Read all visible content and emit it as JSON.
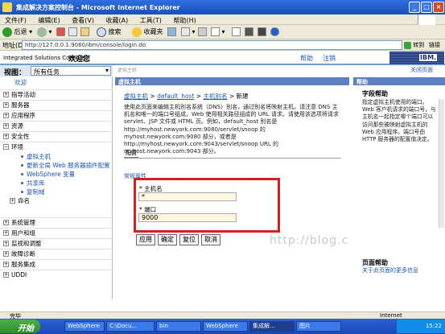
{
  "window": {
    "title": "集成解决方案控制台 - Microsoft Internet Explorer"
  },
  "menu": [
    "文件(F)",
    "编辑(E)",
    "查看(V)",
    "收藏(A)",
    "工具(T)",
    "帮助(H)"
  ],
  "toolbar": {
    "back": "后退",
    "search": "搜索",
    "favorites": "收藏夹"
  },
  "address": {
    "label": "地址(D)",
    "url": "http://127.0.0.1:9060/ibm/console/login.do",
    "go": "转到",
    "links": "链接"
  },
  "console": {
    "title": "Integrated Solutions Console",
    "welcome": "欢迎您",
    "help": "帮助",
    "logout": "注销",
    "ibm": "IBM."
  },
  "nav": {
    "view_label": "视图：",
    "view_value": "所有任务",
    "items": [
      {
        "box": "",
        "label": "欢迎"
      },
      {
        "box": "+",
        "label": "指导活动"
      },
      {
        "box": "+",
        "label": "服务器"
      },
      {
        "box": "+",
        "label": "应用程序"
      },
      {
        "box": "+",
        "label": "资源"
      },
      {
        "box": "+",
        "label": "安全性"
      },
      {
        "box": "−",
        "label": "环境"
      }
    ],
    "sub_items": [
      "虚拟主机",
      "更新全局 Web 服务器插件配置",
      "WebSphere 变量",
      "共享库",
      "复制域"
    ],
    "naming": "命名",
    "items2": [
      {
        "box": "+",
        "label": "系统管理"
      },
      {
        "box": "+",
        "label": "用户和组"
      },
      {
        "box": "+",
        "label": "监视和调整"
      },
      {
        "box": "+",
        "label": "故障诊断"
      },
      {
        "box": "+",
        "label": "服务集成"
      },
      {
        "box": "+",
        "label": "UDDI"
      }
    ]
  },
  "main": {
    "top_crumb": "虚拟主机",
    "panel_title": "虚拟主机",
    "breadcrumb": {
      "a": "虚拟主机",
      "b": "default_host",
      "c": "主机别名",
      "d": "新建"
    },
    "description": "使用此页面来编辑主机别名系统（DNS）别名，通过别名将映射主机。请注意 DNS 主机名和唯一的端口号组成，Web 使用相关路径组成的 URL 请求。请使用该选项将请求 servlet、JSP 文件或 HTML 页。例如，default_host 别名是 http://myhost.newyork.com:9080/servlet/snoop 的 myhost.newyork.com:9080 部分，或者是 http://myhost.newyork.com:9043/servlet/snoop URL 的 myhost.newyork.com:9043 部分。",
    "tab": "配置",
    "section": "常规属性",
    "host_label": "* 主机名",
    "host_value": "*",
    "port_label": "* 端口",
    "port_value": "9000",
    "buttons": {
      "apply": "应用",
      "ok": "确定",
      "reset": "复位",
      "cancel": "取消"
    },
    "watermark": "http://blog.csdn.net/"
  },
  "help": {
    "top_link": "关闭页面",
    "header": "帮助",
    "field_help_title": "字段帮助",
    "field_help_body": "指定虚拟主机使用的端口。Web 客户机请求的端口号，与主机名一起指定哪个端口可以访问那些被映射虚拟主机的 Web 应用程序。端口号由 HTTP 服务器的配置值决定。",
    "page_help_title": "页面帮助",
    "page_help_more": "关于此页面的更多信息"
  },
  "status": {
    "done": "完毕",
    "zone": "Internet"
  },
  "taskbar": {
    "start": "开始",
    "tasks": [
      "WebSphere",
      "C:\\Docu...",
      "bin",
      "WebSphere",
      "集成解...",
      "图片"
    ],
    "time": "15:22"
  }
}
